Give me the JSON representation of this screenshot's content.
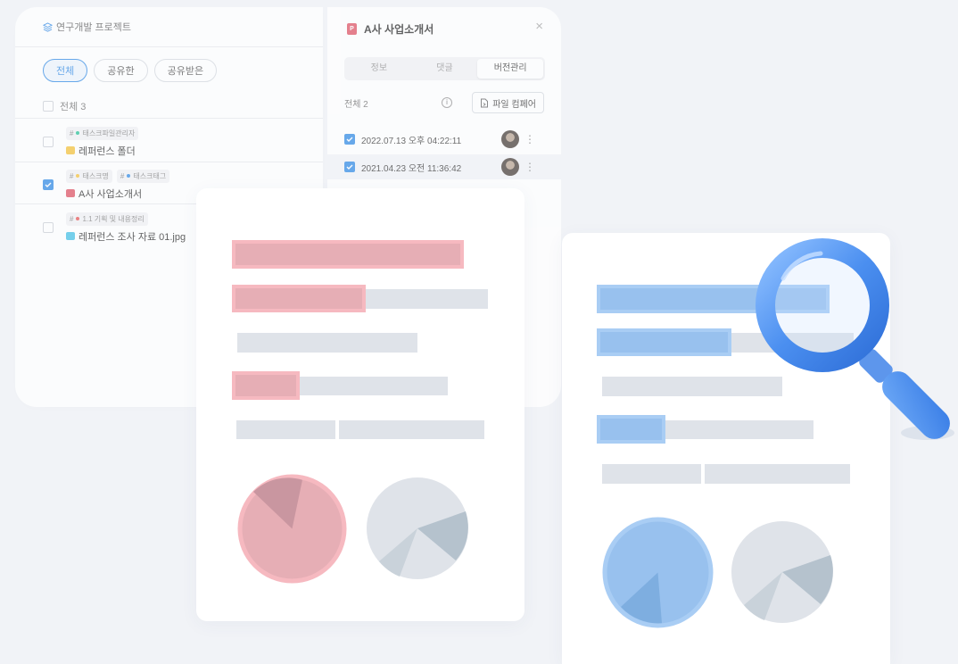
{
  "project": {
    "title": "연구개발 프로젝트"
  },
  "filters": [
    "전체",
    "공유한",
    "공유받은"
  ],
  "list": {
    "all_label": "전체 3",
    "files": [
      {
        "tags": [
          {
            "label": "태스크파일관리자",
            "color": "#2fc49a"
          }
        ],
        "name": "레퍼런스 폴더",
        "icon": "folder-icon",
        "icon_color": "#f5c542",
        "checked": false
      },
      {
        "tags": [
          {
            "label": "태스크명",
            "color": "#f5c542"
          },
          {
            "label": "태스크태그",
            "color": "#3a8fe6"
          }
        ],
        "name": "A사 사업소개서",
        "icon": "pdf-doc-icon",
        "icon_color": "#e05a6a",
        "checked": true
      },
      {
        "tags": [
          {
            "label": "1.1 기획 및 내용정리",
            "color": "#e85b5b"
          }
        ],
        "name": "레퍼런스 조사 자료 01.jpg",
        "icon": "image-file-icon",
        "icon_color": "#4cc3e8",
        "checked": false
      }
    ]
  },
  "detail": {
    "title": "A사 사업소개서",
    "doc_icon_letter": "P",
    "tabs": [
      "정보",
      "댓글",
      "버전관리"
    ],
    "active_tab": 2,
    "versions_count_label": "전체 2",
    "compare_label": "파일 컴페어",
    "versions": [
      {
        "date": "2022.07.13 오후 04:22:11",
        "checked": true
      },
      {
        "date": "2021.04.23 오전 11:36:42",
        "checked": true
      }
    ]
  },
  "colors": {
    "accent": "#3a8fe6",
    "highlight_red": "#e6aeb5",
    "highlight_blue": "#98c1ee"
  }
}
